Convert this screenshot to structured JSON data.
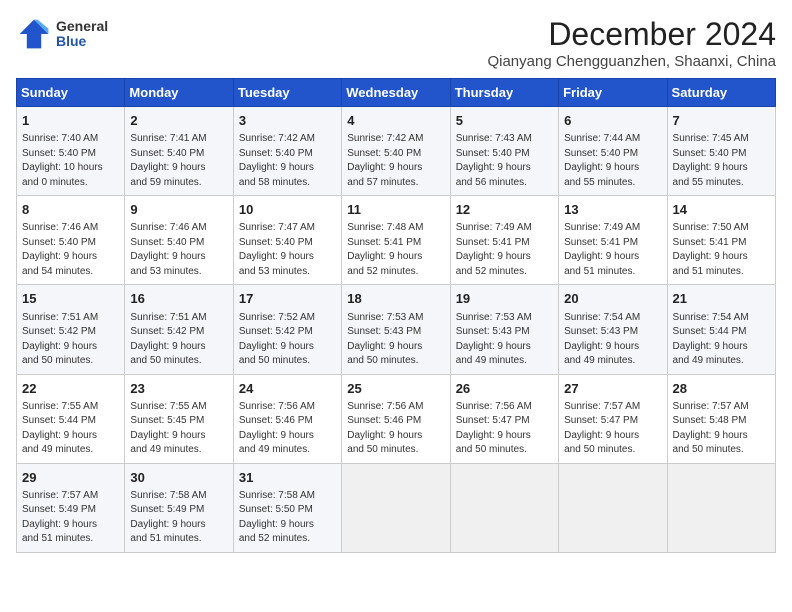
{
  "header": {
    "logo_general": "General",
    "logo_blue": "Blue",
    "month_title": "December 2024",
    "location": "Qianyang Chengguanzhen, Shaanxi, China"
  },
  "days_of_week": [
    "Sunday",
    "Monday",
    "Tuesday",
    "Wednesday",
    "Thursday",
    "Friday",
    "Saturday"
  ],
  "weeks": [
    [
      {
        "day": "1",
        "info": "Sunrise: 7:40 AM\nSunset: 5:40 PM\nDaylight: 10 hours\nand 0 minutes."
      },
      {
        "day": "2",
        "info": "Sunrise: 7:41 AM\nSunset: 5:40 PM\nDaylight: 9 hours\nand 59 minutes."
      },
      {
        "day": "3",
        "info": "Sunrise: 7:42 AM\nSunset: 5:40 PM\nDaylight: 9 hours\nand 58 minutes."
      },
      {
        "day": "4",
        "info": "Sunrise: 7:42 AM\nSunset: 5:40 PM\nDaylight: 9 hours\nand 57 minutes."
      },
      {
        "day": "5",
        "info": "Sunrise: 7:43 AM\nSunset: 5:40 PM\nDaylight: 9 hours\nand 56 minutes."
      },
      {
        "day": "6",
        "info": "Sunrise: 7:44 AM\nSunset: 5:40 PM\nDaylight: 9 hours\nand 55 minutes."
      },
      {
        "day": "7",
        "info": "Sunrise: 7:45 AM\nSunset: 5:40 PM\nDaylight: 9 hours\nand 55 minutes."
      }
    ],
    [
      {
        "day": "8",
        "info": "Sunrise: 7:46 AM\nSunset: 5:40 PM\nDaylight: 9 hours\nand 54 minutes."
      },
      {
        "day": "9",
        "info": "Sunrise: 7:46 AM\nSunset: 5:40 PM\nDaylight: 9 hours\nand 53 minutes."
      },
      {
        "day": "10",
        "info": "Sunrise: 7:47 AM\nSunset: 5:40 PM\nDaylight: 9 hours\nand 53 minutes."
      },
      {
        "day": "11",
        "info": "Sunrise: 7:48 AM\nSunset: 5:41 PM\nDaylight: 9 hours\nand 52 minutes."
      },
      {
        "day": "12",
        "info": "Sunrise: 7:49 AM\nSunset: 5:41 PM\nDaylight: 9 hours\nand 52 minutes."
      },
      {
        "day": "13",
        "info": "Sunrise: 7:49 AM\nSunset: 5:41 PM\nDaylight: 9 hours\nand 51 minutes."
      },
      {
        "day": "14",
        "info": "Sunrise: 7:50 AM\nSunset: 5:41 PM\nDaylight: 9 hours\nand 51 minutes."
      }
    ],
    [
      {
        "day": "15",
        "info": "Sunrise: 7:51 AM\nSunset: 5:42 PM\nDaylight: 9 hours\nand 50 minutes."
      },
      {
        "day": "16",
        "info": "Sunrise: 7:51 AM\nSunset: 5:42 PM\nDaylight: 9 hours\nand 50 minutes."
      },
      {
        "day": "17",
        "info": "Sunrise: 7:52 AM\nSunset: 5:42 PM\nDaylight: 9 hours\nand 50 minutes."
      },
      {
        "day": "18",
        "info": "Sunrise: 7:53 AM\nSunset: 5:43 PM\nDaylight: 9 hours\nand 50 minutes."
      },
      {
        "day": "19",
        "info": "Sunrise: 7:53 AM\nSunset: 5:43 PM\nDaylight: 9 hours\nand 49 minutes."
      },
      {
        "day": "20",
        "info": "Sunrise: 7:54 AM\nSunset: 5:43 PM\nDaylight: 9 hours\nand 49 minutes."
      },
      {
        "day": "21",
        "info": "Sunrise: 7:54 AM\nSunset: 5:44 PM\nDaylight: 9 hours\nand 49 minutes."
      }
    ],
    [
      {
        "day": "22",
        "info": "Sunrise: 7:55 AM\nSunset: 5:44 PM\nDaylight: 9 hours\nand 49 minutes."
      },
      {
        "day": "23",
        "info": "Sunrise: 7:55 AM\nSunset: 5:45 PM\nDaylight: 9 hours\nand 49 minutes."
      },
      {
        "day": "24",
        "info": "Sunrise: 7:56 AM\nSunset: 5:46 PM\nDaylight: 9 hours\nand 49 minutes."
      },
      {
        "day": "25",
        "info": "Sunrise: 7:56 AM\nSunset: 5:46 PM\nDaylight: 9 hours\nand 50 minutes."
      },
      {
        "day": "26",
        "info": "Sunrise: 7:56 AM\nSunset: 5:47 PM\nDaylight: 9 hours\nand 50 minutes."
      },
      {
        "day": "27",
        "info": "Sunrise: 7:57 AM\nSunset: 5:47 PM\nDaylight: 9 hours\nand 50 minutes."
      },
      {
        "day": "28",
        "info": "Sunrise: 7:57 AM\nSunset: 5:48 PM\nDaylight: 9 hours\nand 50 minutes."
      }
    ],
    [
      {
        "day": "29",
        "info": "Sunrise: 7:57 AM\nSunset: 5:49 PM\nDaylight: 9 hours\nand 51 minutes."
      },
      {
        "day": "30",
        "info": "Sunrise: 7:58 AM\nSunset: 5:49 PM\nDaylight: 9 hours\nand 51 minutes."
      },
      {
        "day": "31",
        "info": "Sunrise: 7:58 AM\nSunset: 5:50 PM\nDaylight: 9 hours\nand 52 minutes."
      },
      {
        "day": "",
        "info": ""
      },
      {
        "day": "",
        "info": ""
      },
      {
        "day": "",
        "info": ""
      },
      {
        "day": "",
        "info": ""
      }
    ]
  ]
}
